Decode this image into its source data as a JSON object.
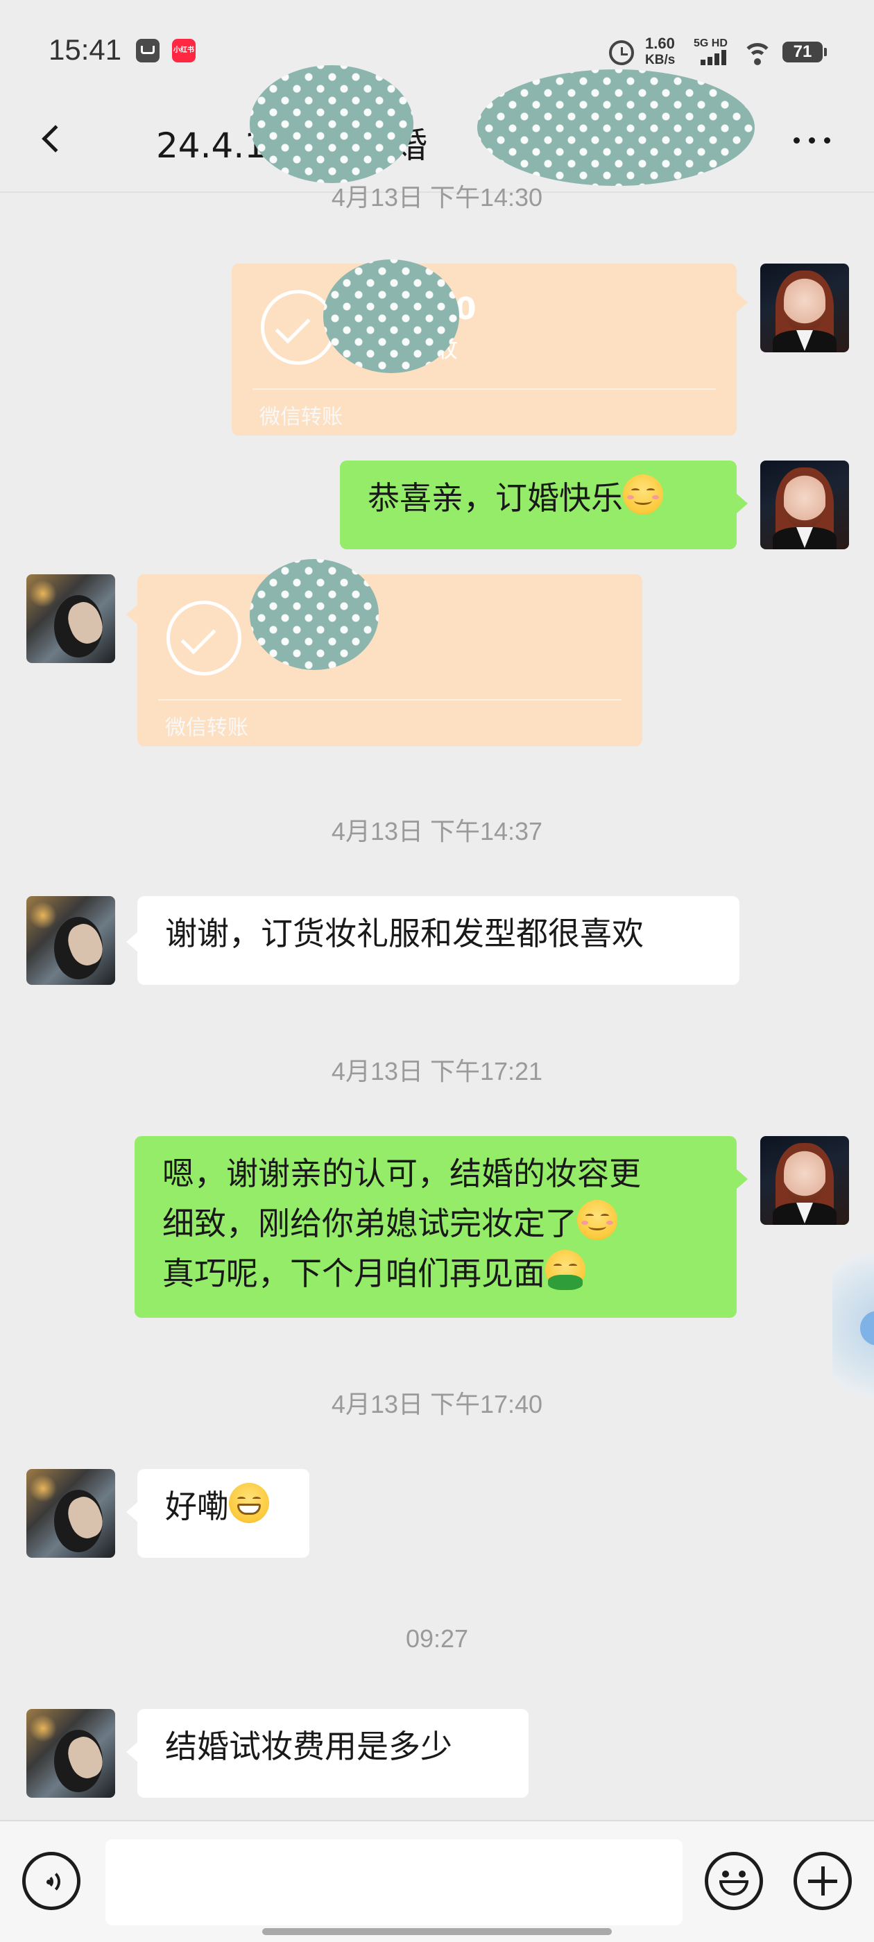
{
  "status_bar": {
    "time": "15:41",
    "notification_icons": [
      "mail-icon",
      "xiaohongshu-icon"
    ],
    "app_badge_text": "小红书",
    "net_speed_value": "1.60",
    "net_speed_unit": "KB/s",
    "network_label": "5G HD",
    "battery": "71"
  },
  "header": {
    "title_prefix": "24.4.1",
    "title_mid": "订婚",
    "back_icon": "chevron-left-icon",
    "more_icon": "more-dots-icon"
  },
  "messages": {
    "ts1": "4月13日 下午14:30",
    "transfer_self": {
      "label": "微信转账",
      "partial_amount": "0",
      "partial_note": "收"
    },
    "msg_self_1": "恭喜亲，订婚快乐",
    "transfer_other": {
      "label": "微信转账"
    },
    "ts2": "4月13日 下午14:37",
    "msg_other_1": "谢谢，订货妆礼服和发型都很喜欢",
    "ts3": "4月13日 下午17:21",
    "msg_self_2_line1": "嗯，谢谢亲的认可，结婚的妆容更",
    "msg_self_2_line2": "细致，刚给你弟媳试完妆定了",
    "msg_self_2_line3": "真巧呢，下个月咱们再见面",
    "ts4": "4月13日 下午17:40",
    "msg_other_2": "好嘞",
    "ts5": "09:27",
    "msg_other_3": "结婚试妆费用是多少"
  },
  "input_bar": {
    "voice_icon": "voice-icon",
    "emoji_icon": "emoji-icon",
    "plus_icon": "plus-icon",
    "input_value": ""
  },
  "colors": {
    "background": "#ededed",
    "self_bubble": "#95ec69",
    "other_bubble": "#ffffff",
    "transfer_card": "#fde0c2",
    "timestamp": "#9a9a9a"
  }
}
